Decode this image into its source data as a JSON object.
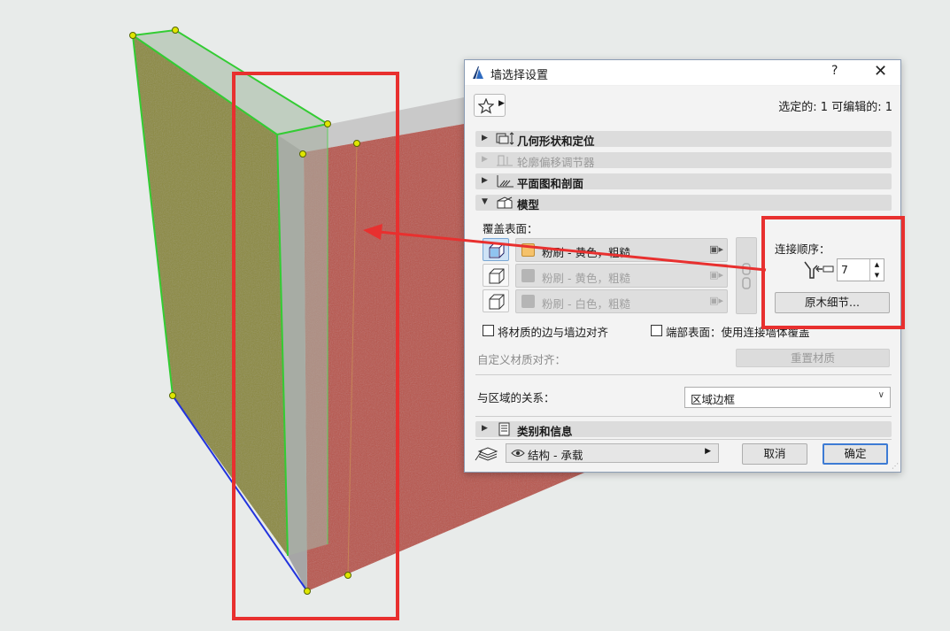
{
  "dialog": {
    "title": "墙选择设置",
    "help": "?",
    "close": "✕",
    "selected_info": "选定的: 1 可编辑的: 1",
    "sections": [
      {
        "label": "几何形状和定位",
        "enabled": true,
        "expanded": false
      },
      {
        "label": "轮廓偏移调节器",
        "enabled": false,
        "expanded": false
      },
      {
        "label": "平面图和剖面",
        "enabled": true,
        "expanded": false
      },
      {
        "label": "模型",
        "enabled": true,
        "expanded": true
      }
    ],
    "model": {
      "cover_surface_label": "覆盖表面：",
      "surfaces": [
        {
          "name": "粉刷 - 黄色，粗糙",
          "color": "#f5c26b",
          "active": true
        },
        {
          "name": "粉刷 - 黄色，粗糙",
          "color": "#9a9a9a",
          "active": false
        },
        {
          "name": "粉刷 - 白色，粗糙",
          "color": "#9a9a9a",
          "active": false
        }
      ],
      "connection_order_label": "连接顺序：",
      "connection_order_value": "7",
      "log_details_button": "原木细节...",
      "align_material_edge": "将材质的边与墙边对齐",
      "end_surface": "端部表面：使用连接墙体覆盖",
      "custom_material_align": "自定义材质对齐：",
      "reset_material_button": "重置材质",
      "zone_relation_label": "与区域的关系：",
      "zone_relation_value": "区域边框"
    },
    "category_section": "类别和信息",
    "layer_value": "结构 - 承载",
    "cancel_button": "取消",
    "ok_button": "确定"
  },
  "colors": {
    "wall_face": "#b8554b",
    "wall_side": "#a4a4a4",
    "wall_top": "#c8c8c8",
    "selection_green": "#33cc33",
    "selection_blue": "#2233dd",
    "highlight_red": "#e8302f",
    "accent_blue": "#3d7bd4"
  }
}
